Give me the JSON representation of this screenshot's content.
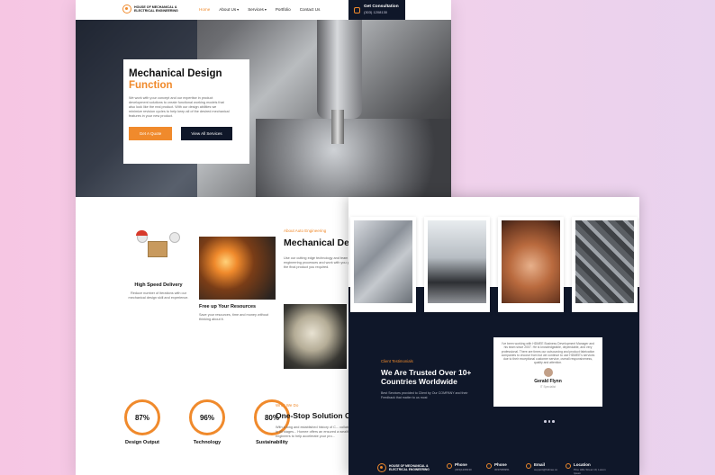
{
  "brand": {
    "logo_text": "HOUSE OF MECHANICAL & ELECTRICAL ENGINEERING"
  },
  "nav": {
    "items": [
      {
        "label": "Home",
        "active": true
      },
      {
        "label": "About Us",
        "dropdown": true
      },
      {
        "label": "Services",
        "dropdown": true
      },
      {
        "label": "Portfolio"
      },
      {
        "label": "Contact Us"
      }
    ],
    "cta": {
      "label": "Get Consultation",
      "phone": "(303) 1208130"
    }
  },
  "hero": {
    "title_line1": "Mechanical Design",
    "title_line2": "Function",
    "description": "We work with your concept and our expertise in product development solutions to create functional working models that also look like the real product. With our design abilities we minimize revision cycles to help keep all of the desired mechanical features in your new product.",
    "primary_button": "Get A Quote",
    "secondary_button": "View All Services"
  },
  "features": [
    {
      "title": "High Speed Delivery",
      "description": "Reduce number of iterations with our mechanical design skill and experience."
    },
    {
      "title": "Free up Your Resources",
      "description": "Save your resources, time and money without thinking about it."
    }
  ],
  "about": {
    "eyebrow": "About Auto Engineering",
    "title": "Mechanical Design Function",
    "description": "Use our cutting edge technology and team to bring your concept to the HDMEE engineering processes and work with you providing the prototype project to have the final product you required."
  },
  "stats": [
    {
      "value": "87%",
      "label": "Design Output"
    },
    {
      "value": "96%",
      "label": "Technology"
    },
    {
      "value": "80%",
      "label": "Sustainability"
    }
  ],
  "what_we_do": {
    "eyebrow": "What We Do",
    "title": "One-Stop Solution Of Development And Design",
    "description": "With a long and established history of C... collaborate with customers in all stages... Homee offers an ensured a wealth of kno... and engineers to help accelerate your pro..."
  },
  "testimonials": {
    "eyebrow": "Client Testimonials",
    "title": "We Are Trusted Over 10+ Countries Worldwide",
    "description": "Best Services provided to Client by Our COMPANY and their Feedback that matter to us most",
    "quote": "I’ve been working with HDMEE Business Development Manager and his team since 2007. He is knowledgeable, dependable, and very professional. There are times our outsourcing and product fabrication companies to choose from but we continue to use HDMEE’s services due to their exceptional customer service, overall responsiveness, quality and attention.",
    "name": "Gerald Flynn",
    "role": "IT Specialist"
  },
  "footer": {
    "items": [
      {
        "label": "Phone",
        "value": "(303)1208130"
      },
      {
        "label": "Phone",
        "value": "3037080951"
      },
      {
        "label": "Email",
        "value": "support@hdmee.co"
      },
      {
        "label": "Location",
        "value": "Pine Hills Street 10, Lorem Ipsum"
      }
    ]
  },
  "colors": {
    "accent": "#f08a2c",
    "dark": "#0f1729"
  }
}
